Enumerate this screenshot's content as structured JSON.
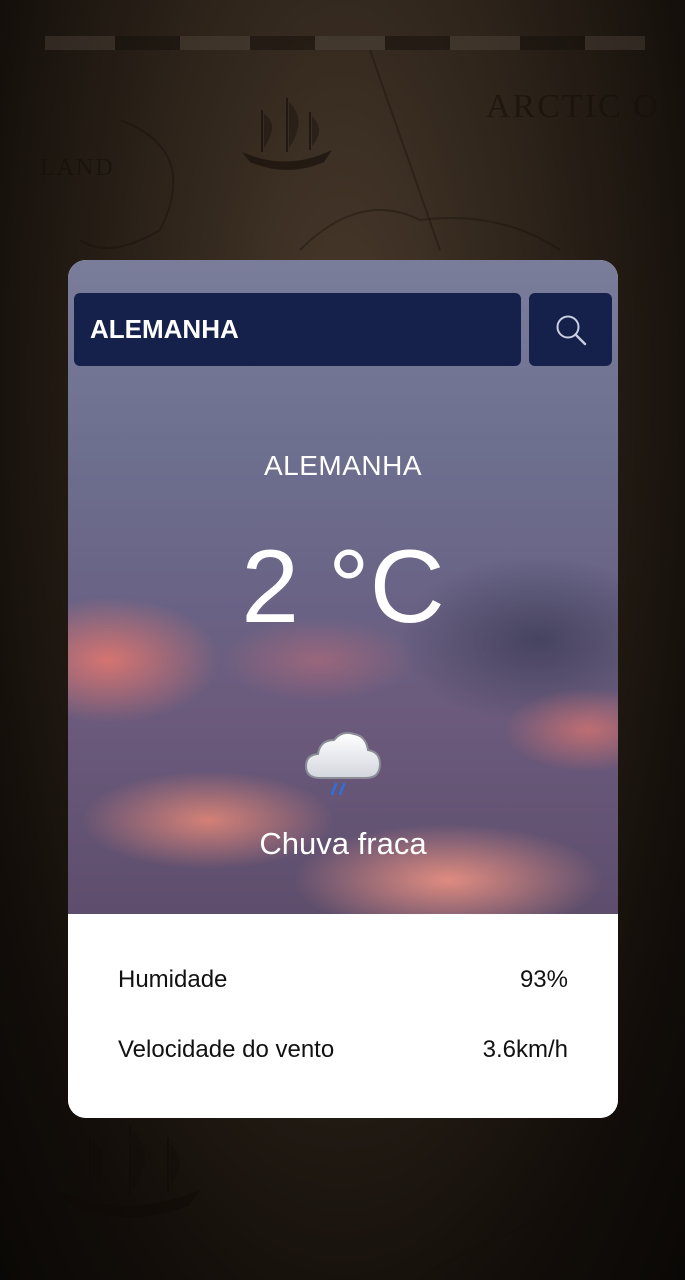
{
  "background": {
    "map_labels": [
      "ARCTIC O",
      "LAND"
    ]
  },
  "search": {
    "value": "ALEMANHA",
    "button_icon": "search-icon"
  },
  "weather": {
    "city": "ALEMANHA",
    "temperature": "2 °C",
    "icon": "cloud-rain-icon",
    "condition": "Chuva fraca"
  },
  "details": {
    "humidity": {
      "label": "Humidade",
      "value": "93%"
    },
    "wind": {
      "label": "Velocidade do vento",
      "value": "3.6km/h"
    }
  },
  "colors": {
    "search_bg": "#15214a",
    "card_bg": "#ffffff",
    "text_light": "#ffffff",
    "text_dark": "#111111"
  }
}
